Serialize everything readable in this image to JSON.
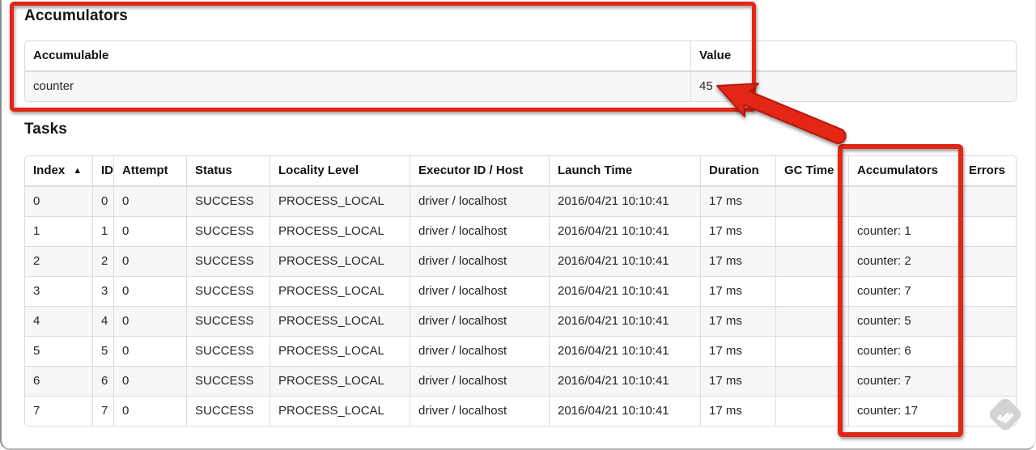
{
  "accumulators_section": {
    "title": "Accumulators",
    "table": {
      "headers": [
        "Accumulable",
        "Value"
      ],
      "rows": [
        [
          "counter",
          "45"
        ]
      ]
    }
  },
  "tasks_section": {
    "title": "Tasks",
    "table": {
      "headers": [
        "Index",
        "ID",
        "Attempt",
        "Status",
        "Locality Level",
        "Executor ID / Host",
        "Launch Time",
        "Duration",
        "GC Time",
        "Accumulators",
        "Errors"
      ],
      "sort_column": "Index",
      "sort_icon": "▲",
      "rows": [
        [
          "0",
          "0",
          "0",
          "SUCCESS",
          "PROCESS_LOCAL",
          "driver / localhost",
          "2016/04/21 10:10:41",
          "17 ms",
          "",
          "",
          ""
        ],
        [
          "1",
          "1",
          "0",
          "SUCCESS",
          "PROCESS_LOCAL",
          "driver / localhost",
          "2016/04/21 10:10:41",
          "17 ms",
          "",
          "counter: 1",
          ""
        ],
        [
          "2",
          "2",
          "0",
          "SUCCESS",
          "PROCESS_LOCAL",
          "driver / localhost",
          "2016/04/21 10:10:41",
          "17 ms",
          "",
          "counter: 2",
          ""
        ],
        [
          "3",
          "3",
          "0",
          "SUCCESS",
          "PROCESS_LOCAL",
          "driver / localhost",
          "2016/04/21 10:10:41",
          "17 ms",
          "",
          "counter: 7",
          ""
        ],
        [
          "4",
          "4",
          "0",
          "SUCCESS",
          "PROCESS_LOCAL",
          "driver / localhost",
          "2016/04/21 10:10:41",
          "17 ms",
          "",
          "counter: 5",
          ""
        ],
        [
          "5",
          "5",
          "0",
          "SUCCESS",
          "PROCESS_LOCAL",
          "driver / localhost",
          "2016/04/21 10:10:41",
          "17 ms",
          "",
          "counter: 6",
          ""
        ],
        [
          "6",
          "6",
          "0",
          "SUCCESS",
          "PROCESS_LOCAL",
          "driver / localhost",
          "2016/04/21 10:10:41",
          "17 ms",
          "",
          "counter: 7",
          ""
        ],
        [
          "7",
          "7",
          "0",
          "SUCCESS",
          "PROCESS_LOCAL",
          "driver / localhost",
          "2016/04/21 10:10:41",
          "17 ms",
          "",
          "counter: 17",
          ""
        ]
      ]
    }
  },
  "annotations": {
    "color": "#e32817",
    "arrow_outline_color": "#b5170a"
  },
  "watermark": {
    "color": "#d3d3d3"
  }
}
